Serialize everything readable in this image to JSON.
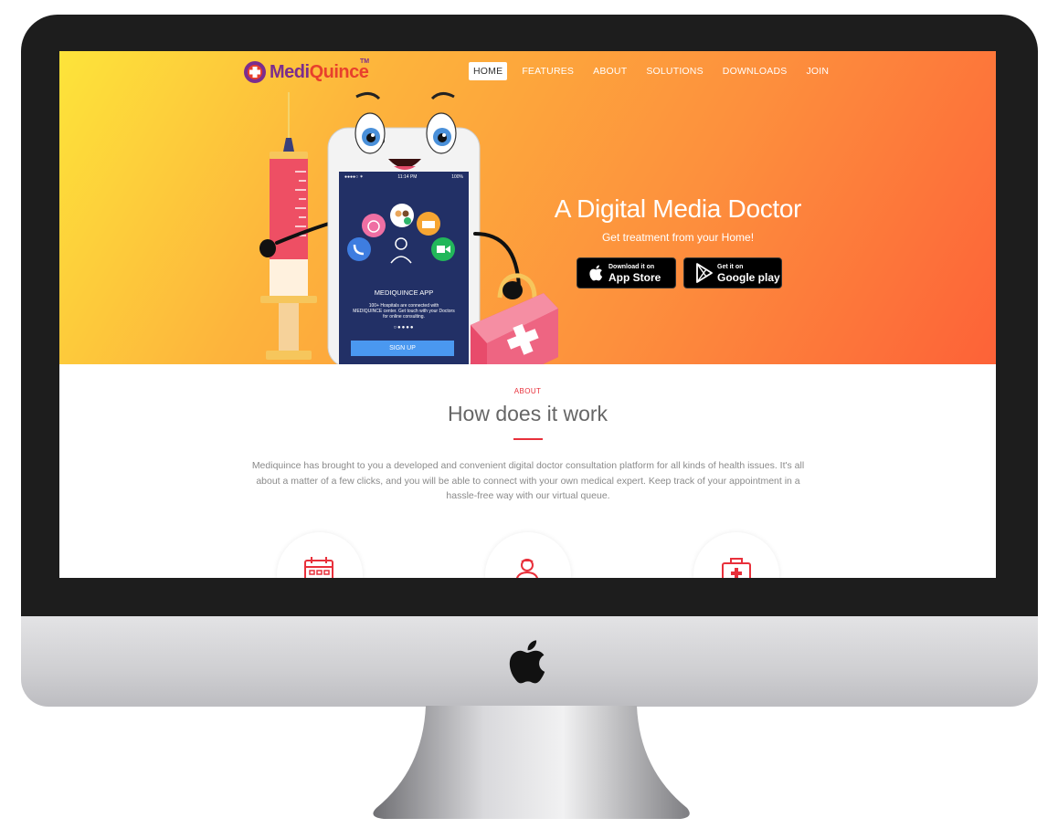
{
  "brand": {
    "name_left": "Medi",
    "name_right": "Quince",
    "trademark": "TM"
  },
  "nav": {
    "items": [
      {
        "label": "HOME",
        "active": true
      },
      {
        "label": "FEATURES",
        "active": false
      },
      {
        "label": "ABOUT",
        "active": false
      },
      {
        "label": "SOLUTIONS",
        "active": false
      },
      {
        "label": "DOWNLOADS",
        "active": false
      },
      {
        "label": "JOIN",
        "active": false
      }
    ]
  },
  "hero": {
    "title": "A Digital Media Doctor",
    "subtitle": "Get treatment from your Home!",
    "app_store": {
      "small": "Download it on",
      "big": "App Store"
    },
    "google_play": {
      "small": "Get it on",
      "big": "Google play"
    }
  },
  "phone": {
    "status_time": "11:14 PM",
    "status_battery": "100%",
    "app_name": "MEDIQUINCE APP",
    "app_desc_1": "100+ Hospitals are connected with",
    "app_desc_2": "MEDIQUINCE center. Get touch with your Doctors",
    "app_desc_3": "for online consulting.",
    "signup_label": "SIGN UP"
  },
  "about": {
    "tag": "ABOUT",
    "title": "How does it work",
    "description": "Mediquince has brought to you a developed and convenient digital doctor consultation platform for all kinds of health issues. It's all about a matter of a few clicks, and you will be able to connect with your own medical expert. Keep track of your appointment in a hassle-free way with our virtual queue."
  },
  "features": [
    {
      "icon": "calendar-icon"
    },
    {
      "icon": "doctor-icon"
    },
    {
      "icon": "medical-kit-icon"
    }
  ],
  "colors": {
    "accent": "#e8303b",
    "hero_gradient_start": "#fde43a",
    "hero_gradient_end": "#fd6238",
    "bezel": "#1d1d1d",
    "brand_purple": "#7b2d8e"
  }
}
